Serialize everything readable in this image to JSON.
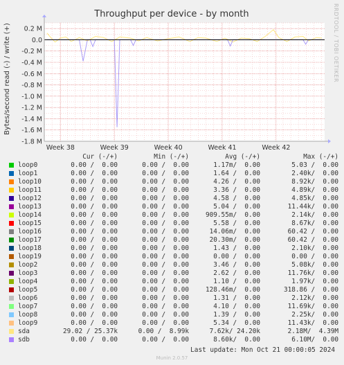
{
  "chart_data": {
    "type": "line",
    "title": "Throughput per device - by month",
    "ylabel": "Bytes/second read (-) / write (+)",
    "side_label": "RRDTOOL / TOBI OETIKER",
    "ylim": [
      -1800000,
      300000
    ],
    "yticks": [
      {
        "value": 200000,
        "label": "0.2 M"
      },
      {
        "value": 0,
        "label": "0.0"
      },
      {
        "value": -200000,
        "label": "-0.2 M"
      },
      {
        "value": -400000,
        "label": "-0.4 M"
      },
      {
        "value": -600000,
        "label": "-0.6 M"
      },
      {
        "value": -800000,
        "label": "-0.8 M"
      },
      {
        "value": -1000000,
        "label": "-1.0 M"
      },
      {
        "value": -1200000,
        "label": "-1.2 M"
      },
      {
        "value": -1400000,
        "label": "-1.4 M"
      },
      {
        "value": -1600000,
        "label": "-1.6 M"
      },
      {
        "value": -1800000,
        "label": "-1.8 M"
      }
    ],
    "xlim": [
      37.7,
      42.9
    ],
    "xticks": [
      {
        "value": 38,
        "label": "Week 38"
      },
      {
        "value": 39,
        "label": "Week 39"
      },
      {
        "value": 40,
        "label": "Week 40"
      },
      {
        "value": 41,
        "label": "Week 41"
      },
      {
        "value": 42,
        "label": "Week 42"
      }
    ],
    "series": [
      {
        "name": "sda",
        "color": "#ffe680",
        "points": [
          [
            37.75,
            120000
          ],
          [
            37.8,
            60000
          ],
          [
            37.9,
            -40000
          ],
          [
            38.0,
            30000
          ],
          [
            38.1,
            50000
          ],
          [
            38.2,
            -30000
          ],
          [
            38.35,
            40000
          ],
          [
            38.5,
            -20000
          ],
          [
            38.65,
            60000
          ],
          [
            38.8,
            40000
          ],
          [
            38.95,
            -30000
          ],
          [
            39.1,
            50000
          ],
          [
            39.3,
            30000
          ],
          [
            39.45,
            -20000
          ],
          [
            39.6,
            40000
          ],
          [
            39.8,
            -20000
          ],
          [
            40.0,
            20000
          ],
          [
            40.2,
            50000
          ],
          [
            40.4,
            -30000
          ],
          [
            40.55,
            40000
          ],
          [
            40.7,
            30000
          ],
          [
            40.9,
            -30000
          ],
          [
            41.05,
            30000
          ],
          [
            41.2,
            -40000
          ],
          [
            41.35,
            30000
          ],
          [
            41.5,
            20000
          ],
          [
            41.65,
            -30000
          ],
          [
            41.8,
            60000
          ],
          [
            41.95,
            180000
          ],
          [
            42.05,
            40000
          ],
          [
            42.2,
            -30000
          ],
          [
            42.35,
            50000
          ],
          [
            42.5,
            60000
          ],
          [
            42.6,
            -20000
          ],
          [
            42.75,
            40000
          ],
          [
            42.85,
            30000
          ]
        ]
      },
      {
        "name": "sdb",
        "color": "#a99bf7",
        "points": [
          [
            37.75,
            0
          ],
          [
            38.35,
            0
          ],
          [
            38.42,
            -380000
          ],
          [
            38.5,
            0
          ],
          [
            38.55,
            0
          ],
          [
            38.6,
            -120000
          ],
          [
            38.65,
            0
          ],
          [
            39.0,
            0
          ],
          [
            39.05,
            -1550000
          ],
          [
            39.1,
            0
          ],
          [
            39.3,
            0
          ],
          [
            39.35,
            -100000
          ],
          [
            39.4,
            0
          ],
          [
            41.1,
            0
          ],
          [
            41.15,
            -110000
          ],
          [
            41.2,
            0
          ],
          [
            42.5,
            0
          ],
          [
            42.55,
            -80000
          ],
          [
            42.6,
            0
          ],
          [
            42.85,
            0
          ]
        ]
      }
    ]
  },
  "legend": {
    "headers": {
      "cur": "Cur (-/+)",
      "min": "Min (-/+)",
      "avg": "Avg (-/+)",
      "max": "Max (-/+)"
    },
    "rows": [
      {
        "name": "loop0",
        "color": "#00cc00",
        "cur": "0.00 /  0.00",
        "min": "0.00 /  0.00",
        "avg": "1.17m/  0.00",
        "max": "5.03 /  0.00"
      },
      {
        "name": "loop1",
        "color": "#0066b3",
        "cur": "0.00 /  0.00",
        "min": "0.00 /  0.00",
        "avg": "1.64 /  0.00",
        "max": "2.40k/  0.00"
      },
      {
        "name": "loop10",
        "color": "#ff8000",
        "cur": "0.00 /  0.00",
        "min": "0.00 /  0.00",
        "avg": "4.26 /  0.00",
        "max": "8.92k/  0.00"
      },
      {
        "name": "loop11",
        "color": "#ffcc00",
        "cur": "0.00 /  0.00",
        "min": "0.00 /  0.00",
        "avg": "3.36 /  0.00",
        "max": "4.89k/  0.00"
      },
      {
        "name": "loop12",
        "color": "#330099",
        "cur": "0.00 /  0.00",
        "min": "0.00 /  0.00",
        "avg": "4.58 /  0.00",
        "max": "4.85k/  0.00"
      },
      {
        "name": "loop13",
        "color": "#990099",
        "cur": "0.00 /  0.00",
        "min": "0.00 /  0.00",
        "avg": "5.04 /  0.00",
        "max": "11.44k/  0.00"
      },
      {
        "name": "loop14",
        "color": "#ccff00",
        "cur": "0.00 /  0.00",
        "min": "0.00 /  0.00",
        "avg": "909.55m/  0.00",
        "max": "2.14k/  0.00"
      },
      {
        "name": "loop15",
        "color": "#ff0000",
        "cur": "0.00 /  0.00",
        "min": "0.00 /  0.00",
        "avg": "5.58 /  0.00",
        "max": "8.67k/  0.00"
      },
      {
        "name": "loop16",
        "color": "#808080",
        "cur": "0.00 /  0.00",
        "min": "0.00 /  0.00",
        "avg": "14.06m/  0.00",
        "max": "60.42 /  0.00"
      },
      {
        "name": "loop17",
        "color": "#008f00",
        "cur": "0.00 /  0.00",
        "min": "0.00 /  0.00",
        "avg": "20.30m/  0.00",
        "max": "60.42 /  0.00"
      },
      {
        "name": "loop18",
        "color": "#00487d",
        "cur": "0.00 /  0.00",
        "min": "0.00 /  0.00",
        "avg": "1.43 /  0.00",
        "max": "2.10k/  0.00"
      },
      {
        "name": "loop19",
        "color": "#b35a00",
        "cur": "0.00 /  0.00",
        "min": "0.00 /  0.00",
        "avg": "0.00 /  0.00",
        "max": "0.00 /  0.00"
      },
      {
        "name": "loop2",
        "color": "#b38f00",
        "cur": "0.00 /  0.00",
        "min": "0.00 /  0.00",
        "avg": "3.46 /  0.00",
        "max": "5.08k/  0.00"
      },
      {
        "name": "loop3",
        "color": "#6b006b",
        "cur": "0.00 /  0.00",
        "min": "0.00 /  0.00",
        "avg": "2.62 /  0.00",
        "max": "11.76k/  0.00"
      },
      {
        "name": "loop4",
        "color": "#8fb300",
        "cur": "0.00 /  0.00",
        "min": "0.00 /  0.00",
        "avg": "1.10 /  0.00",
        "max": "1.97k/  0.00"
      },
      {
        "name": "loop5",
        "color": "#b30000",
        "cur": "0.00 /  0.00",
        "min": "0.00 /  0.00",
        "avg": "128.46m/  0.00",
        "max": "318.86 /  0.00"
      },
      {
        "name": "loop6",
        "color": "#bebebe",
        "cur": "0.00 /  0.00",
        "min": "0.00 /  0.00",
        "avg": "1.31 /  0.00",
        "max": "2.12k/  0.00"
      },
      {
        "name": "loop7",
        "color": "#80ff80",
        "cur": "0.00 /  0.00",
        "min": "0.00 /  0.00",
        "avg": "4.10 /  0.00",
        "max": "11.69k/  0.00"
      },
      {
        "name": "loop8",
        "color": "#80c9ff",
        "cur": "0.00 /  0.00",
        "min": "0.00 /  0.00",
        "avg": "1.39 /  0.00",
        "max": "2.25k/  0.00"
      },
      {
        "name": "loop9",
        "color": "#ffc080",
        "cur": "0.00 /  0.00",
        "min": "0.00 /  0.00",
        "avg": "5.34 /  0.00",
        "max": "11.43k/  0.00"
      },
      {
        "name": "sda",
        "color": "#ffe680",
        "cur": "29.02 / 25.37k",
        "min": "0.00 /  8.99k",
        "avg": "7.62k/ 24.20k",
        "max": "2.18M/  4.39M"
      },
      {
        "name": "sdb",
        "color": "#aa80ff",
        "cur": "0.00 /  0.00",
        "min": "0.00 /  0.00",
        "avg": "8.60k/  0.00",
        "max": "6.10M/  0.00"
      }
    ]
  },
  "last_update": "Last update: Mon Oct 21 00:00:05 2024",
  "footer": "Munin 2.0.57"
}
